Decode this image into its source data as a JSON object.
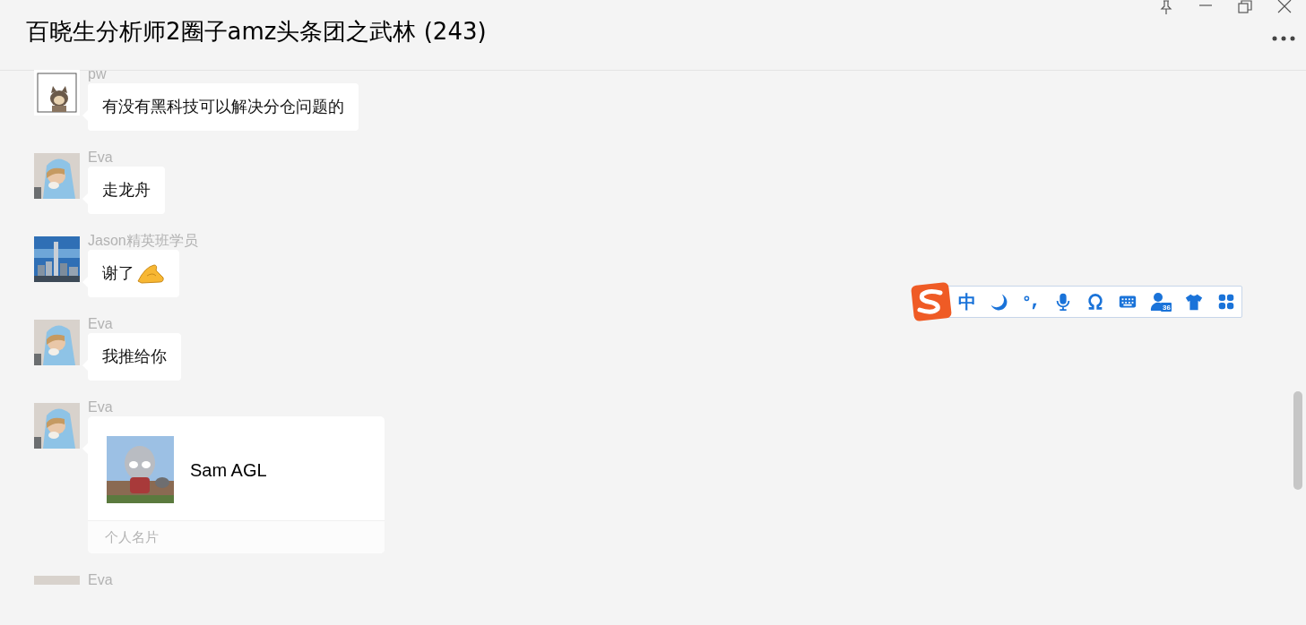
{
  "window": {
    "title": "百晓生分析师2圈子amz头条团之武林 (243)"
  },
  "messages": [
    {
      "sender": "pw",
      "kind": "text",
      "text": "有没有黑科技可以解决分仓问题的",
      "emoji": false
    },
    {
      "sender": "Eva",
      "kind": "text",
      "text": "走龙舟",
      "emoji": false
    },
    {
      "sender": "Jason精英班学员",
      "kind": "text",
      "text": "谢了",
      "emoji": true
    },
    {
      "sender": "Eva",
      "kind": "text",
      "text": "我推给你",
      "emoji": false
    },
    {
      "sender": "Eva",
      "kind": "card",
      "card_name": "Sam AGL",
      "card_footer": "个人名片"
    },
    {
      "sender": "Eva",
      "kind": "partial"
    }
  ],
  "ime_toolbar": {
    "mode": "中",
    "badge": "36"
  }
}
